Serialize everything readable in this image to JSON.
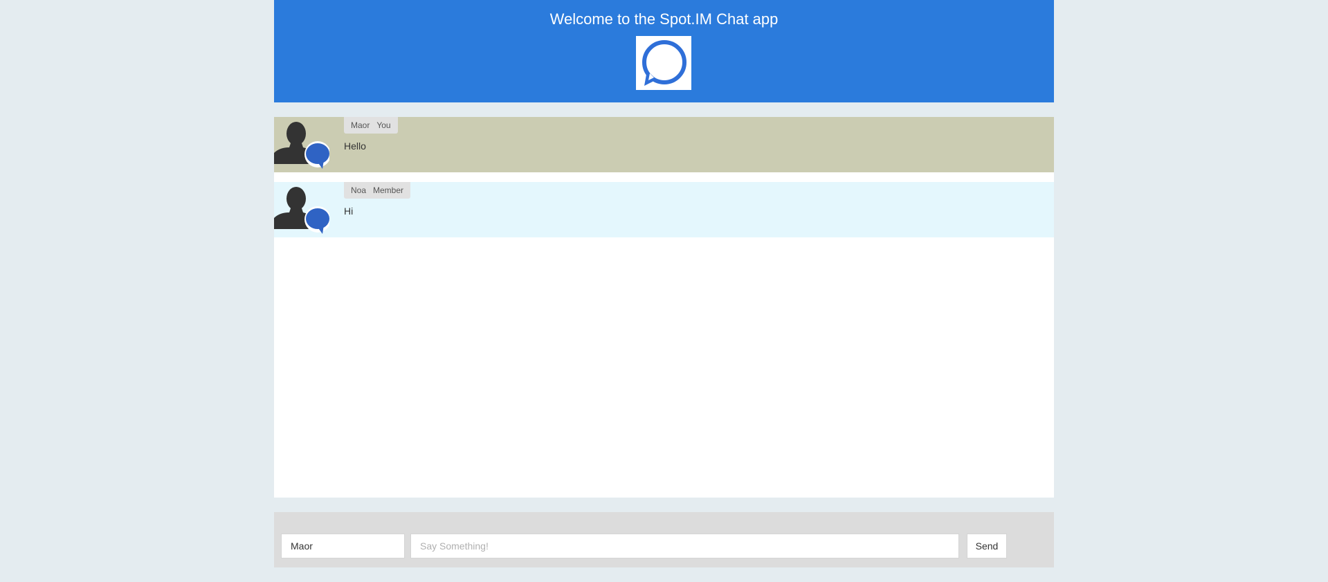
{
  "header": {
    "title": "Welcome to the Spot.IM Chat app",
    "logo_icon": "chat-bubble-icon",
    "background": "#2b7bdc"
  },
  "messages": [
    {
      "author": "Maor",
      "role": "You",
      "text": "Hello",
      "background": "#cbccb2",
      "avatar_icon": "user-chat-avatar-icon"
    },
    {
      "author": "Noa",
      "role": "Member",
      "text": "Hi",
      "background": "#e4f7fd",
      "avatar_icon": "user-chat-avatar-icon"
    }
  ],
  "composer": {
    "name_value": "Maor",
    "message_placeholder": "Say Something!",
    "message_value": "",
    "send_label": "Send"
  },
  "colors": {
    "page_background": "#e4ecf0",
    "accent": "#2b7bdc",
    "avatar_bubble": "#2f63c4"
  }
}
